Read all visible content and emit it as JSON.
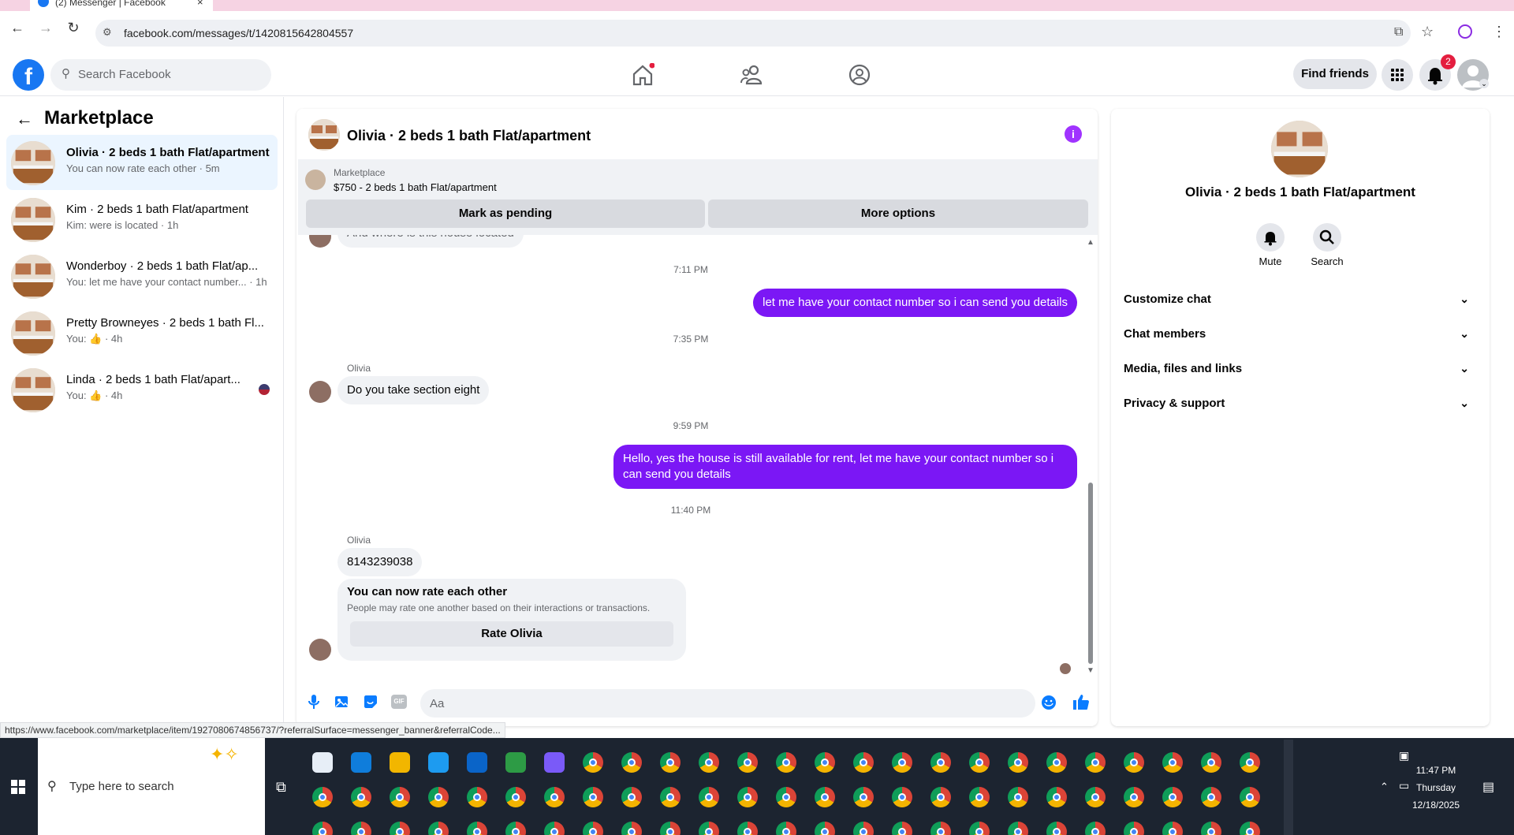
{
  "browser": {
    "tab_title": "(2) Messenger | Facebook",
    "url": "facebook.com/messages/t/1420815642804557"
  },
  "header": {
    "search_placeholder": "Search Facebook",
    "find_friends": "Find friends",
    "notification_count": "2",
    "brand_color": "#1877f2"
  },
  "sidebar": {
    "title": "Marketplace",
    "conversations": [
      {
        "name": "Olivia · 2 beds 1 bath Flat/apartment",
        "sub": "You can now rate each other · 5m",
        "active": true
      },
      {
        "name": "Kim · 2 beds 1 bath Flat/apartment",
        "sub": "Kim: were is located · 1h"
      },
      {
        "name": "Wonderboy · 2 beds 1 bath Flat/ap...",
        "sub": "You: let me have your contact number... · 1h"
      },
      {
        "name": "Pretty Browneyes · 2 beds 1 bath Fl...",
        "sub": "You: 👍 · 4h"
      },
      {
        "name": "Linda · 2 beds 1 bath Flat/apart...",
        "sub": "You: 👍 · 4h"
      }
    ]
  },
  "chat": {
    "title": "Olivia · 2 beds 1 bath Flat/apartment",
    "banner_label": "Marketplace",
    "banner_listing": "$750 - 2 beds 1 bath Flat/apartment",
    "mark_pending": "Mark as pending",
    "more_options": "More options",
    "partial_message": "And where is this house located",
    "time1": "7:11 PM",
    "out1": "let me have your contact number so i can send you details",
    "time2": "7:35 PM",
    "sender1": "Olivia",
    "in1": "Do you take section eight",
    "time3": "9:59 PM",
    "out2": "Hello, yes the house is still available for rent, let me have your contact number so i can send you details",
    "time4": "11:40 PM",
    "sender2": "Olivia",
    "in2": "8143239038",
    "rate_title": "You can now rate each other",
    "rate_desc": "People may rate one another based on their interactions or transactions.",
    "rate_button": "Rate Olivia",
    "input_placeholder": "Aa",
    "accent": "#7b17f5"
  },
  "details": {
    "name": "Olivia · 2 beds 1 bath Flat/apartment",
    "mute": "Mute",
    "search": "Search",
    "items": [
      "Customize chat",
      "Chat members",
      "Media, files and links",
      "Privacy & support"
    ]
  },
  "status_url": "https://www.facebook.com/marketplace/item/1927080674856737/?referralSurface=messenger_banner&referralCode...",
  "taskbar": {
    "search_placeholder": "Type here to search",
    "time": "11:47 PM",
    "day": "Thursday",
    "date": "12/18/2025"
  }
}
